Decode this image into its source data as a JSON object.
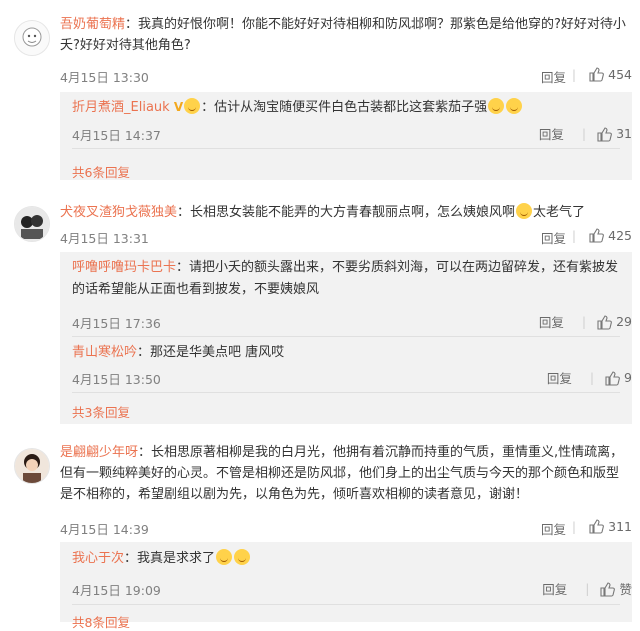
{
  "comments": [
    {
      "username": "吾奶葡萄精",
      "text": "：我真的好恨你啊！你能不能好好对待相柳和防风邶啊？那紫色是给他穿的?好好对待小夭?好好对待其他角色?",
      "time": "4月15日 13:30",
      "reply_label": "回复",
      "likes": "454",
      "replies": [
        {
          "username": "折月煮酒_Eliauk",
          "text": "：估计从淘宝随便买件白色古装都比这套紫茄子强",
          "time": "4月15日 14:37",
          "reply_label": "回复",
          "likes": "31"
        }
      ],
      "more_replies": "共6条回复"
    },
    {
      "username": "犬夜叉渣狗戈薇独美",
      "text": "：长相思女装能不能弄的大方青春靓丽点啊，怎么姨娘风啊",
      "text_tail": "太老气了",
      "time": "4月15日 13:31",
      "reply_label": "回复",
      "likes": "425",
      "replies": [
        {
          "username": "呼噜呼噜玛卡巴卡",
          "text": "：请把小夭的额头露出来，不要劣质斜刘海，可以在两边留碎发，还有紫披发的话希望能从正面也看到披发，不要姨娘风",
          "time": "4月15日 17:36",
          "reply_label": "回复",
          "likes": "29"
        },
        {
          "username": "青山寒松吟",
          "text": "：那还是华美点吧 唐风哎",
          "time": "4月15日 13:50",
          "reply_label": "回复",
          "likes": "9"
        }
      ],
      "more_replies": "共3条回复"
    },
    {
      "username": "是翩翩少年呀",
      "text": "：长相思原著相柳是我的白月光，他拥有着沉静而持重的气质，重情重义,性情疏离，但有一颗纯粹美好的心灵。不管是相柳还是防风邶，他们身上的出尘气质与今天的那个颜色和版型是不相称的，希望剧组以剧为先，以角色为先，倾听喜欢相柳的读者意见，谢谢！",
      "time": "4月15日 14:39",
      "reply_label": "回复",
      "likes": "311",
      "replies": [
        {
          "username": "我心于次",
          "text": "：我真是求求了",
          "time": "4月15日 19:09",
          "reply_label": "回复",
          "likes": "赞"
        }
      ],
      "more_replies": "共8条回复"
    }
  ],
  "colors": {
    "username": "#eb7350",
    "thread_bg": "#f2f2f2",
    "meta": "#808080"
  }
}
